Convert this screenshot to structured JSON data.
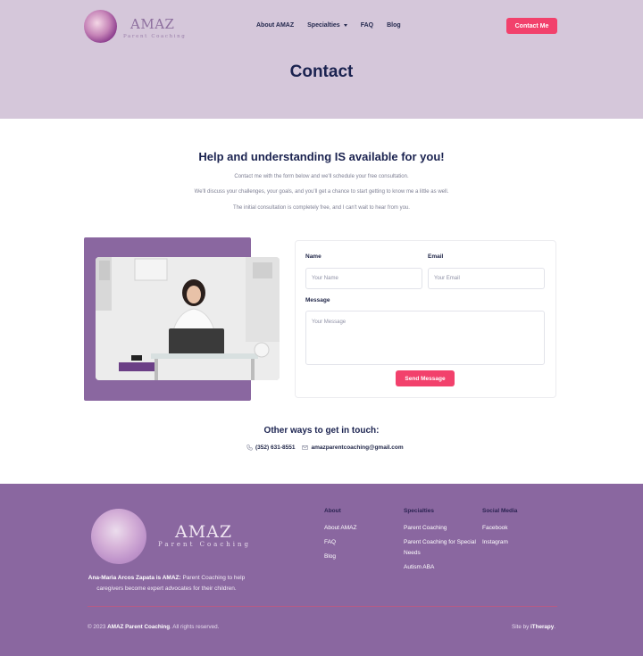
{
  "header": {
    "logo_word": "AMAZ",
    "logo_sub": "Parent Coaching",
    "nav": [
      {
        "label": "About AMAZ"
      },
      {
        "label": "Specialties",
        "has_dropdown": true
      },
      {
        "label": "FAQ"
      },
      {
        "label": "Blog"
      }
    ],
    "cta_label": "Contact Me"
  },
  "hero": {
    "title": "Contact"
  },
  "intro": {
    "title": "Help and understanding IS available for you!",
    "paragraphs": [
      "Contact me with the form below and we'll schedule your free consultation.",
      "We'll discuss your challenges, your goals, and you'll get a chance to start getting to know me a little as well.",
      "The initial consultation is completely free, and I can't wait to hear from you."
    ]
  },
  "form": {
    "name_label": "Name",
    "name_placeholder": "Your Name",
    "email_label": "Email",
    "email_placeholder": "Your Email",
    "message_label": "Message",
    "message_placeholder": "Your Message",
    "submit_label": "Send Message"
  },
  "other": {
    "title": "Other ways to get in touch:",
    "phone": "(352) 631-8551",
    "email": "amazparentcoaching@gmail.com"
  },
  "footer": {
    "logo_word": "AMAZ",
    "logo_sub": "Parent Coaching",
    "about_bold": "Ana-Maria Arcos Zapata is AMAZ:",
    "about_rest": " Parent Coaching to help caregivers become expert advocates for their children.",
    "columns": [
      {
        "heading": "About",
        "links": [
          "About AMAZ",
          "FAQ",
          "Blog"
        ]
      },
      {
        "heading": "Specialties",
        "links": [
          "Parent Coaching",
          "Parent Coaching for Special Needs",
          "Autism ABA"
        ]
      },
      {
        "heading": "Social Media",
        "links": [
          "Facebook",
          "Instagram"
        ]
      }
    ],
    "copy_prefix": "© 2023 ",
    "copy_bold": "AMAZ Parent Coaching",
    "copy_suffix": ". All rights reserved.",
    "site_prefix": "Site by ",
    "site_bold": "iTherapy",
    "site_suffix": "."
  },
  "colors": {
    "accent": "#f2416c",
    "hero_bg": "#d5c7da",
    "purple": "#8a67a0",
    "navy": "#1b2350"
  }
}
